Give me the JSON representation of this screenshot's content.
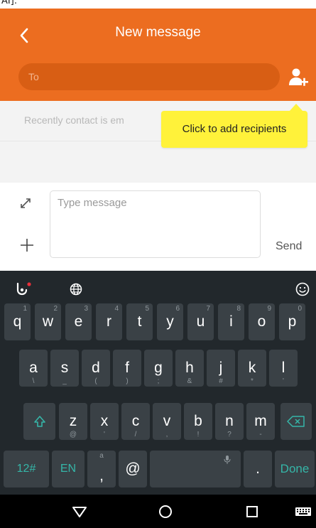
{
  "status_bar": {
    "text": "AI]:"
  },
  "header": {
    "title": "New message"
  },
  "recipient": {
    "placeholder": "To"
  },
  "recent": {
    "text": "Recently contact is em"
  },
  "tooltip": {
    "text": "Click to add recipients"
  },
  "composer": {
    "placeholder": "Type message",
    "send_label": "Send"
  },
  "keyboard": {
    "rows": [
      [
        {
          "c": "q",
          "h": "1"
        },
        {
          "c": "w",
          "h": "2"
        },
        {
          "c": "e",
          "h": "3"
        },
        {
          "c": "r",
          "h": "4"
        },
        {
          "c": "t",
          "h": "5"
        },
        {
          "c": "y",
          "h": "6"
        },
        {
          "c": "u",
          "h": "7"
        },
        {
          "c": "i",
          "h": "8"
        },
        {
          "c": "o",
          "h": "9"
        },
        {
          "c": "p",
          "h": "0"
        }
      ],
      [
        {
          "c": "a",
          "h": "\\"
        },
        {
          "c": "s",
          "h": "_"
        },
        {
          "c": "d",
          "h": "("
        },
        {
          "c": "f",
          "h": ")"
        },
        {
          "c": "g",
          "h": ";"
        },
        {
          "c": "h",
          "h": "&"
        },
        {
          "c": "j",
          "h": "#"
        },
        {
          "c": "k",
          "h": "*"
        },
        {
          "c": "l",
          "h": "'"
        }
      ],
      [
        {
          "c": "z",
          "h": "@"
        },
        {
          "c": "x",
          "h": "'"
        },
        {
          "c": "c",
          "h": "/"
        },
        {
          "c": "v",
          "h": ","
        },
        {
          "c": "b",
          "h": "!"
        },
        {
          "c": "n",
          "h": "?"
        },
        {
          "c": "m",
          "h": "-"
        }
      ]
    ],
    "mode_label": "12#",
    "lang_label": "EN",
    "comma_hint": "a",
    "comma_label": ",",
    "at_label": "@",
    "period_label": ".",
    "done_label": "Done"
  },
  "colors": {
    "accent": "#ec6d20",
    "tooltip": "#fff23a",
    "keyboard_bg": "#22282c",
    "key_bg": "#3a4146",
    "teal": "#35b6a8"
  }
}
